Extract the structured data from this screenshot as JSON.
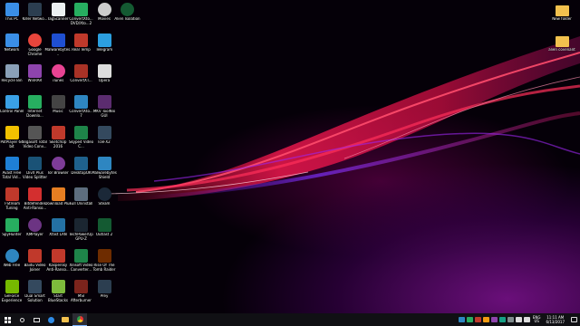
{
  "desktop_icons": [
    {
      "label": "This PC",
      "icon": "computer-icon",
      "color": "#3a8ee6"
    },
    {
      "label": "Network",
      "icon": "network-icon",
      "color": "#3a8ee6"
    },
    {
      "label": "Recycle Bin",
      "icon": "recycle-bin-icon",
      "color": "#8aa0b8"
    },
    {
      "label": "Control Panel",
      "icon": "control-panel-icon",
      "color": "#3aa0e6"
    },
    {
      "label": "PotPlayer 64 bit",
      "icon": "potplayer-icon",
      "color": "#f2c100"
    },
    {
      "label": "Avast Free Total Vid...",
      "icon": "video-converter-icon",
      "color": "#1e7fd6"
    },
    {
      "label": "T-Stream Tuning",
      "icon": "tstream-icon",
      "color": "#c0392b"
    },
    {
      "label": "SpyHunter",
      "icon": "spyhunter-icon",
      "color": "#27ae60"
    },
    {
      "label": "Web Free",
      "icon": "globe-icon",
      "color": "#2e86c1"
    },
    {
      "label": "GeForce Experience",
      "icon": "geforce-icon",
      "color": "#76b900"
    },
    {
      "label": "Killer Netwo...",
      "icon": "killer-network-icon",
      "color": "#2c3e50"
    },
    {
      "label": "Google Chrome",
      "icon": "chrome-icon",
      "color": "#e8453c"
    },
    {
      "label": "WinRAR",
      "icon": "winrar-icon",
      "color": "#8e44ad"
    },
    {
      "label": "Internet Downlo...",
      "icon": "download-manager-icon",
      "color": "#27ae60"
    },
    {
      "label": "Bigasoft Total Video Conv...",
      "icon": "bigasoft-icon",
      "color": "#555555"
    },
    {
      "label": "DivX Plus Video Splitter",
      "icon": "divx-icon",
      "color": "#1a5276"
    },
    {
      "label": "Bitdefender Anti-Ranso...",
      "icon": "bitdefender-icon",
      "color": "#d32f2f"
    },
    {
      "label": "KMPlayer",
      "icon": "kmplayer-icon",
      "color": "#6c3483"
    },
    {
      "label": "Baidu Video Joiner",
      "icon": "video-joiner-icon",
      "color": "#c0392b"
    },
    {
      "label": "Dual Smart Solution",
      "icon": "dual-smart-icon",
      "color": "#34495e"
    },
    {
      "label": "TagScanner",
      "icon": "tagscanner-icon",
      "color": "#ecf0f1"
    },
    {
      "label": "Malwarebytes...",
      "icon": "malwarebytes-icon",
      "color": "#1f4fd1"
    },
    {
      "label": "iTunes",
      "icon": "itunes-icon",
      "color": "#e84393"
    },
    {
      "label": "Music",
      "icon": "headphones-icon",
      "color": "#444444"
    },
    {
      "label": "SketchUp 2016",
      "icon": "sketchup-icon",
      "color": "#c0392b"
    },
    {
      "label": "Tor Browser",
      "icon": "tor-icon",
      "color": "#7d3c98"
    },
    {
      "label": "Download Plus",
      "icon": "download-plus-icon",
      "color": "#e67e22"
    },
    {
      "label": "Xfast LAN",
      "icon": "lan-icon",
      "color": "#2471a3"
    },
    {
      "label": "Kaspersky Anti-Ranso...",
      "icon": "kaspersky-icon",
      "color": "#c0392b"
    },
    {
      "label": "Start BlueStacks",
      "icon": "bluestacks-icon",
      "color": "#7dbb3c"
    },
    {
      "label": "ConvertXto... DVD/Xto...2",
      "icon": "convertx-icon",
      "color": "#27ae60"
    },
    {
      "label": "Real Temp",
      "icon": "realtemp-icon",
      "color": "#c0392b"
    },
    {
      "label": "ConvertXT...",
      "icon": "convertxt-icon",
      "color": "#a93226"
    },
    {
      "label": "ConvertXto... 7",
      "icon": "convertx7-icon",
      "color": "#2e86c1"
    },
    {
      "label": "Skype4 Video C...",
      "icon": "skype-video-icon",
      "color": "#1e8449"
    },
    {
      "label": "DesktopOK",
      "icon": "desktopok-icon",
      "color": "#1f618d"
    },
    {
      "label": "Full Uninstall",
      "icon": "uninstall-icon",
      "color": "#5d6d7e"
    },
    {
      "label": "TechPowerUp GPU-Z",
      "icon": "gpuz-icon",
      "color": "#1b2631"
    },
    {
      "label": "Xilisoft Video Converter...",
      "icon": "xilisoft-icon",
      "color": "#1e8449"
    },
    {
      "label": "MSI Afterburner",
      "icon": "afterburner-icon",
      "color": "#7b241c"
    },
    {
      "label": "Movies",
      "icon": "movies-icon",
      "color": "#cccccc"
    },
    {
      "label": "Telegram",
      "icon": "telegram-icon",
      "color": "#2c9fe0"
    },
    {
      "label": "Opera",
      "icon": "opera-icon",
      "color": "#dddddd"
    },
    {
      "label": "MKV ToolNix GUI",
      "icon": "mkvtoolnix-icon",
      "color": "#5b2c6f"
    },
    {
      "label": "IceFX2",
      "icon": "icefx-icon",
      "color": "#34495e"
    },
    {
      "label": "Malwarebytes Shield",
      "icon": "shield-icon",
      "color": "#2e86c1"
    },
    {
      "label": "Steam",
      "icon": "steam-icon",
      "color": "#1b2838"
    },
    {
      "label": "Outlast 2",
      "icon": "outlast-icon",
      "color": "#145a32"
    },
    {
      "label": "Rise Of The Tomb Raider",
      "icon": "tomb-raider-icon",
      "color": "#6e2c00"
    },
    {
      "label": "Prey",
      "icon": "prey-icon",
      "color": "#2c3e50"
    },
    {
      "label": "Alien Isolation",
      "icon": "alien-icon",
      "color": "#145a32"
    }
  ],
  "right_icons": [
    {
      "label": "New folder",
      "icon": "folder-icon",
      "color": "#f2c14e"
    },
    {
      "label": "alien covenant",
      "icon": "folder-icon",
      "color": "#f2c14e"
    }
  ],
  "taskbar": {
    "start": "start-button",
    "apps": [
      "search-icon",
      "task-view-icon",
      "edge-icon",
      "file-explorer-icon",
      "chrome-icon"
    ]
  },
  "tray": {
    "lang_top": "ENG",
    "lang_bottom": "US",
    "time": "11:11 AM",
    "date": "6/13/2017"
  }
}
